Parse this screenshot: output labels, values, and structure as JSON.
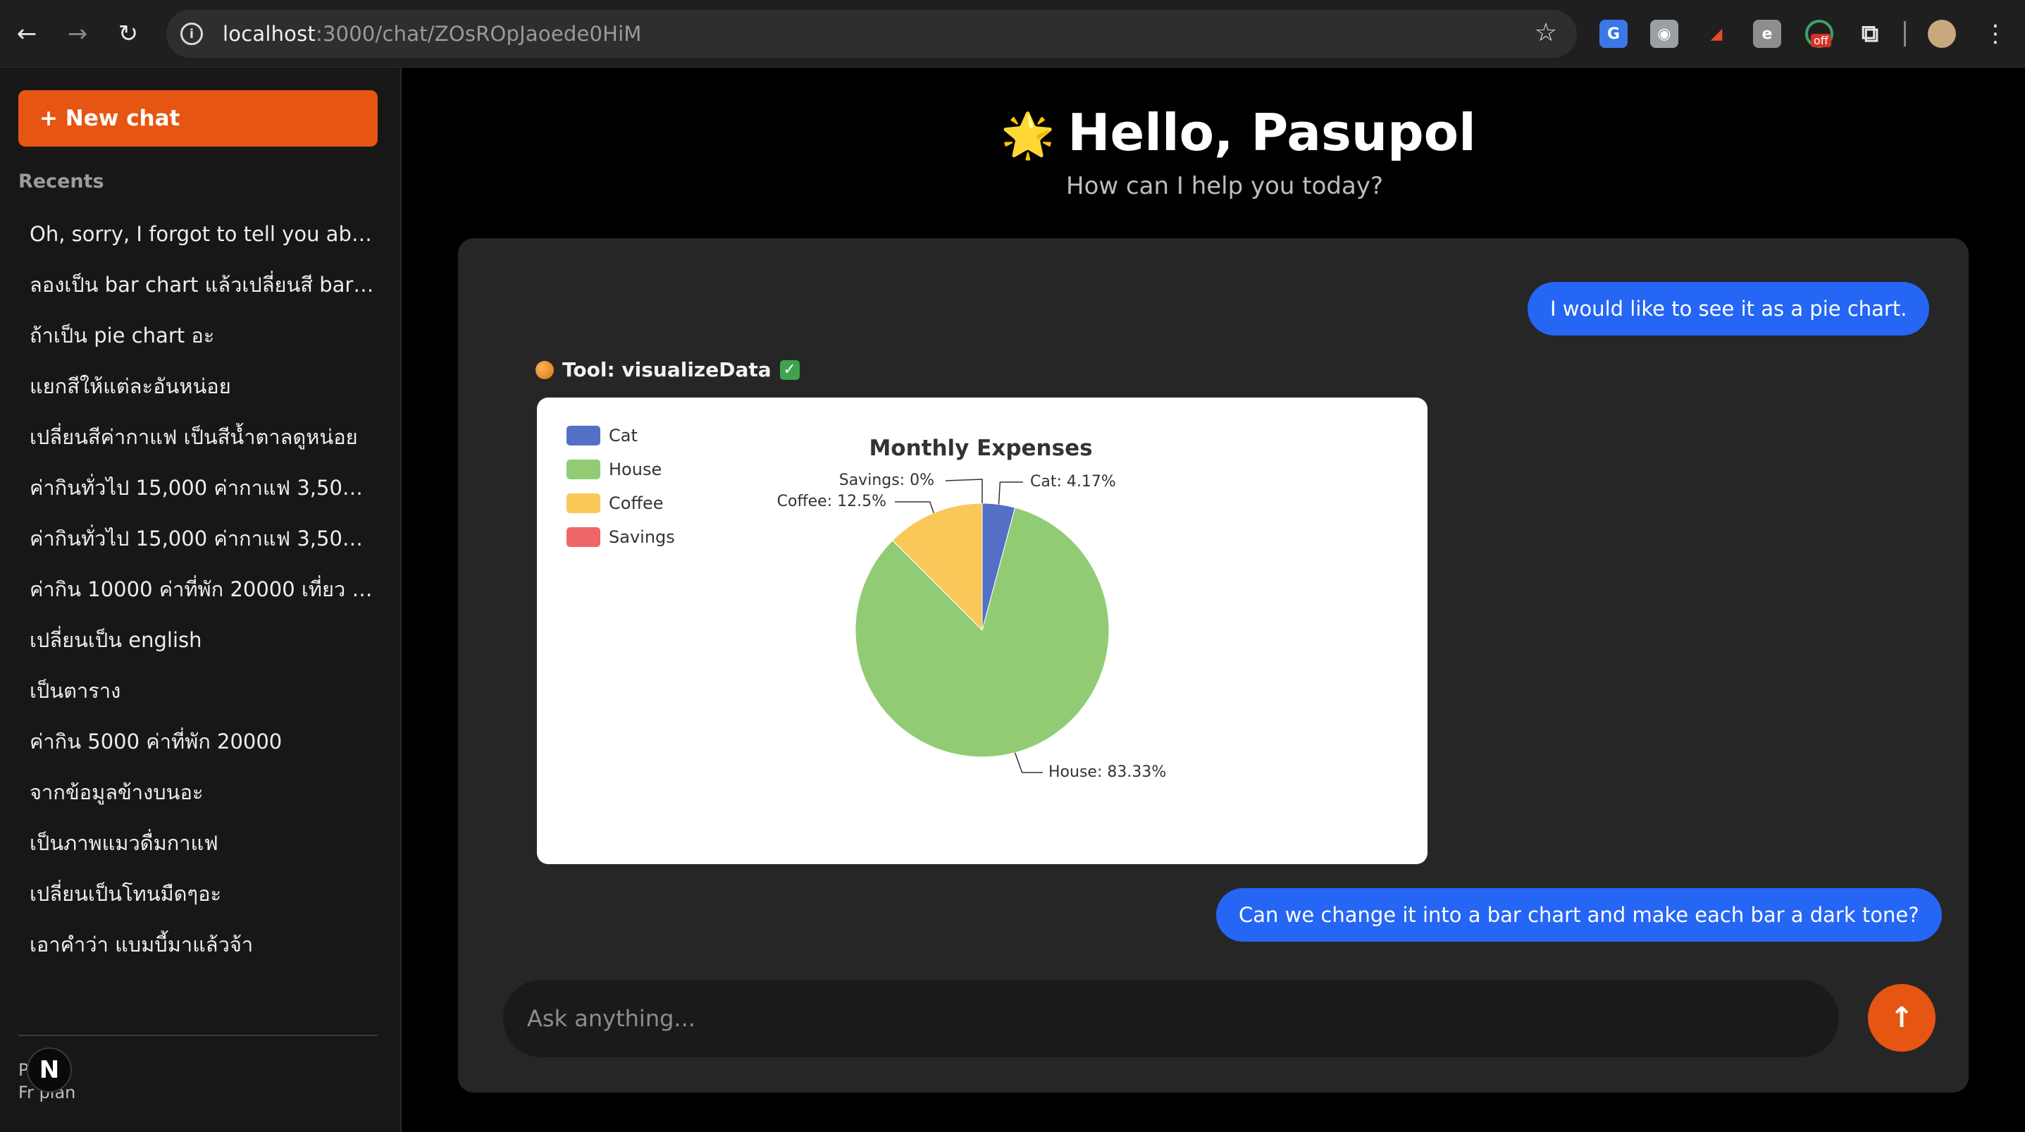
{
  "browser": {
    "url_host": "localhost",
    "url_path": ":3000/chat/ZOsROpJaoede0HiM",
    "extensions": [
      "translate-icon",
      "camera-icon",
      "pdf-icon",
      "e-icon",
      "off-icon",
      "puzzle-icon",
      "profile-icon"
    ],
    "off_badge": "off"
  },
  "sidebar": {
    "new_chat": "+ New chat",
    "recents_title": "Recents",
    "items": [
      "Oh, sorry, I forgot to tell you abo...",
      "ลองเป็น bar chart แล้วเปลี่ยนสี bar ...",
      "ถ้าเป็น pie chart อะ",
      "แยกสีให้แต่ละอันหน่อย",
      "เปลี่ยนสีค่ากาแฟ เป็นสีน้ำตาลดูหน่อย",
      "ค่ากินทั่วไป 15,000 ค่ากาแฟ 3,500 ค่า...",
      "ค่ากินทั่วไป 15,000 ค่ากาแฟ 3,500 ค่า...",
      "ค่ากิน 10000 ค่าที่พัก 20000 เที่ยว 5...",
      "เปลี่ยนเป็น english",
      "เป็นตาราง",
      "ค่ากิน 5000 ค่าที่พัก 20000",
      "จากข้อมูลข้างบนอะ",
      "เป็นภาพแมวดื่มกาแฟ",
      "เปลี่ยนเป็นโทนมืดๆอะ",
      "เอาคำว่า แบมบี้มาแล้วจ้า"
    ],
    "user_name": "P      l",
    "user_plan": "Fr    plan",
    "badge": "N"
  },
  "main": {
    "greeting_icon": "🌟",
    "greeting": "Hello, Pasupol",
    "subtitle": "How can I help you today?",
    "messages": {
      "user_1": "I would like to see it as a pie chart.",
      "tool_label": "Tool: visualizeData",
      "user_2": "Can we change it into a bar chart and make each bar a dark tone?"
    },
    "input_placeholder": "Ask anything...",
    "send_icon": "arrow-up-icon"
  },
  "chart_data": {
    "type": "pie",
    "title": "Monthly Expenses",
    "categories": [
      "Cat",
      "House",
      "Coffee",
      "Savings"
    ],
    "values": [
      4.17,
      83.33,
      12.5,
      0
    ],
    "colors": [
      "#5470c6",
      "#91cc75",
      "#fac858",
      "#ee6666"
    ],
    "labels": [
      "Cat: 4.17%",
      "House: 83.33%",
      "Coffee: 12.5%",
      "Savings: 0%"
    ],
    "legend_position": "top-left"
  }
}
